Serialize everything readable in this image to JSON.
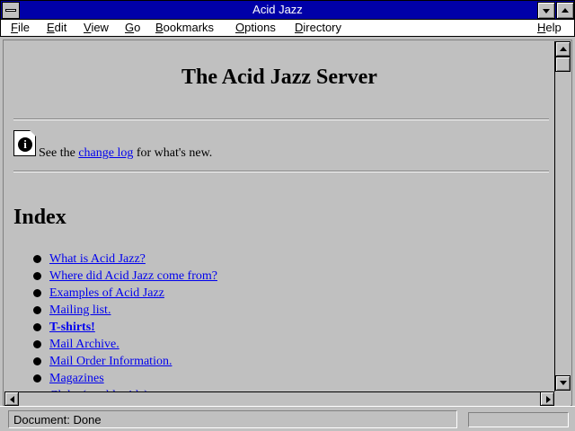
{
  "window": {
    "title": "Acid Jazz"
  },
  "menubar": {
    "items": [
      {
        "accel": "F",
        "rest": "ile"
      },
      {
        "accel": "E",
        "rest": "dit"
      },
      {
        "accel": "V",
        "rest": "iew"
      },
      {
        "accel": "G",
        "rest": "o"
      },
      {
        "accel": "B",
        "rest": "ookmarks"
      },
      {
        "accel": "O",
        "rest": "ptions"
      },
      {
        "accel": "D",
        "rest": "irectory"
      },
      {
        "accel": "H",
        "rest": "elp"
      }
    ]
  },
  "page": {
    "title": "The Acid Jazz Server",
    "info": {
      "prefix": "See the ",
      "link": "change log",
      "suffix": " for what's new."
    },
    "index_heading": "Index",
    "index_items": [
      {
        "label": "What is Acid Jazz?",
        "bold": false
      },
      {
        "label": "Where did Acid Jazz come from?",
        "bold": false
      },
      {
        "label": "Examples of Acid Jazz",
        "bold": false
      },
      {
        "label": "Mailing list.",
        "bold": false
      },
      {
        "label": "T-shirts!",
        "bold": true
      },
      {
        "label": "Mail Archive.",
        "bold": false
      },
      {
        "label": "Mail Order Information.",
        "bold": false
      },
      {
        "label": "Magazines",
        "bold": false
      },
      {
        "label": "Clubs (world-wide)",
        "bold": false
      }
    ]
  },
  "status": {
    "text": "Document: Done"
  },
  "icons": {
    "system_menu": "system-menu-icon",
    "minimize": "minimize-arrow-icon",
    "maximize": "maximize-arrow-icon",
    "info": "info-document-icon",
    "bullet": "bullet-icon"
  },
  "colors": {
    "titlebar": "#0000a8",
    "link": "#0000ee",
    "face": "#c0c0c0"
  }
}
